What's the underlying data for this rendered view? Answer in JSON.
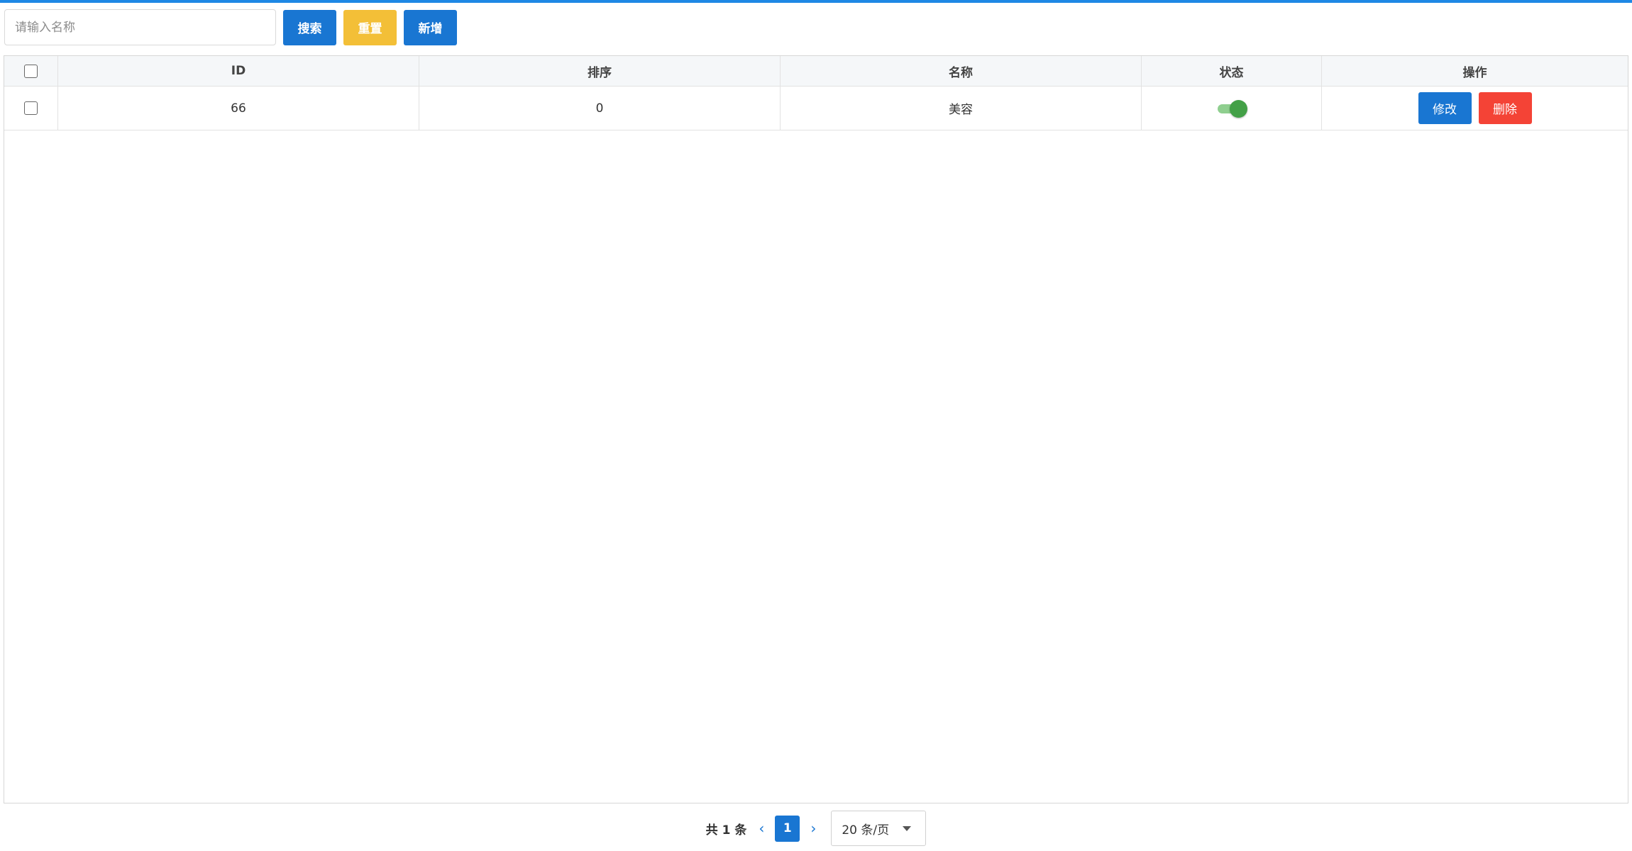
{
  "toolbar": {
    "search_placeholder": "请输入名称",
    "search_label": "搜索",
    "reset_label": "重置",
    "add_label": "新增"
  },
  "table": {
    "columns": [
      "ID",
      "排序",
      "名称",
      "状态",
      "操作"
    ],
    "rows": [
      {
        "id": "66",
        "sort": "0",
        "name": "美容",
        "status": "on",
        "edit_label": "修改",
        "delete_label": "删除"
      }
    ]
  },
  "pagination": {
    "total_text": "共 1 条",
    "current_page": "1",
    "page_size": "20 条/页"
  },
  "colors": {
    "primary": "#1976d2",
    "warning": "#f3bf37",
    "danger": "#f44336",
    "switch_on": "#43a047"
  }
}
